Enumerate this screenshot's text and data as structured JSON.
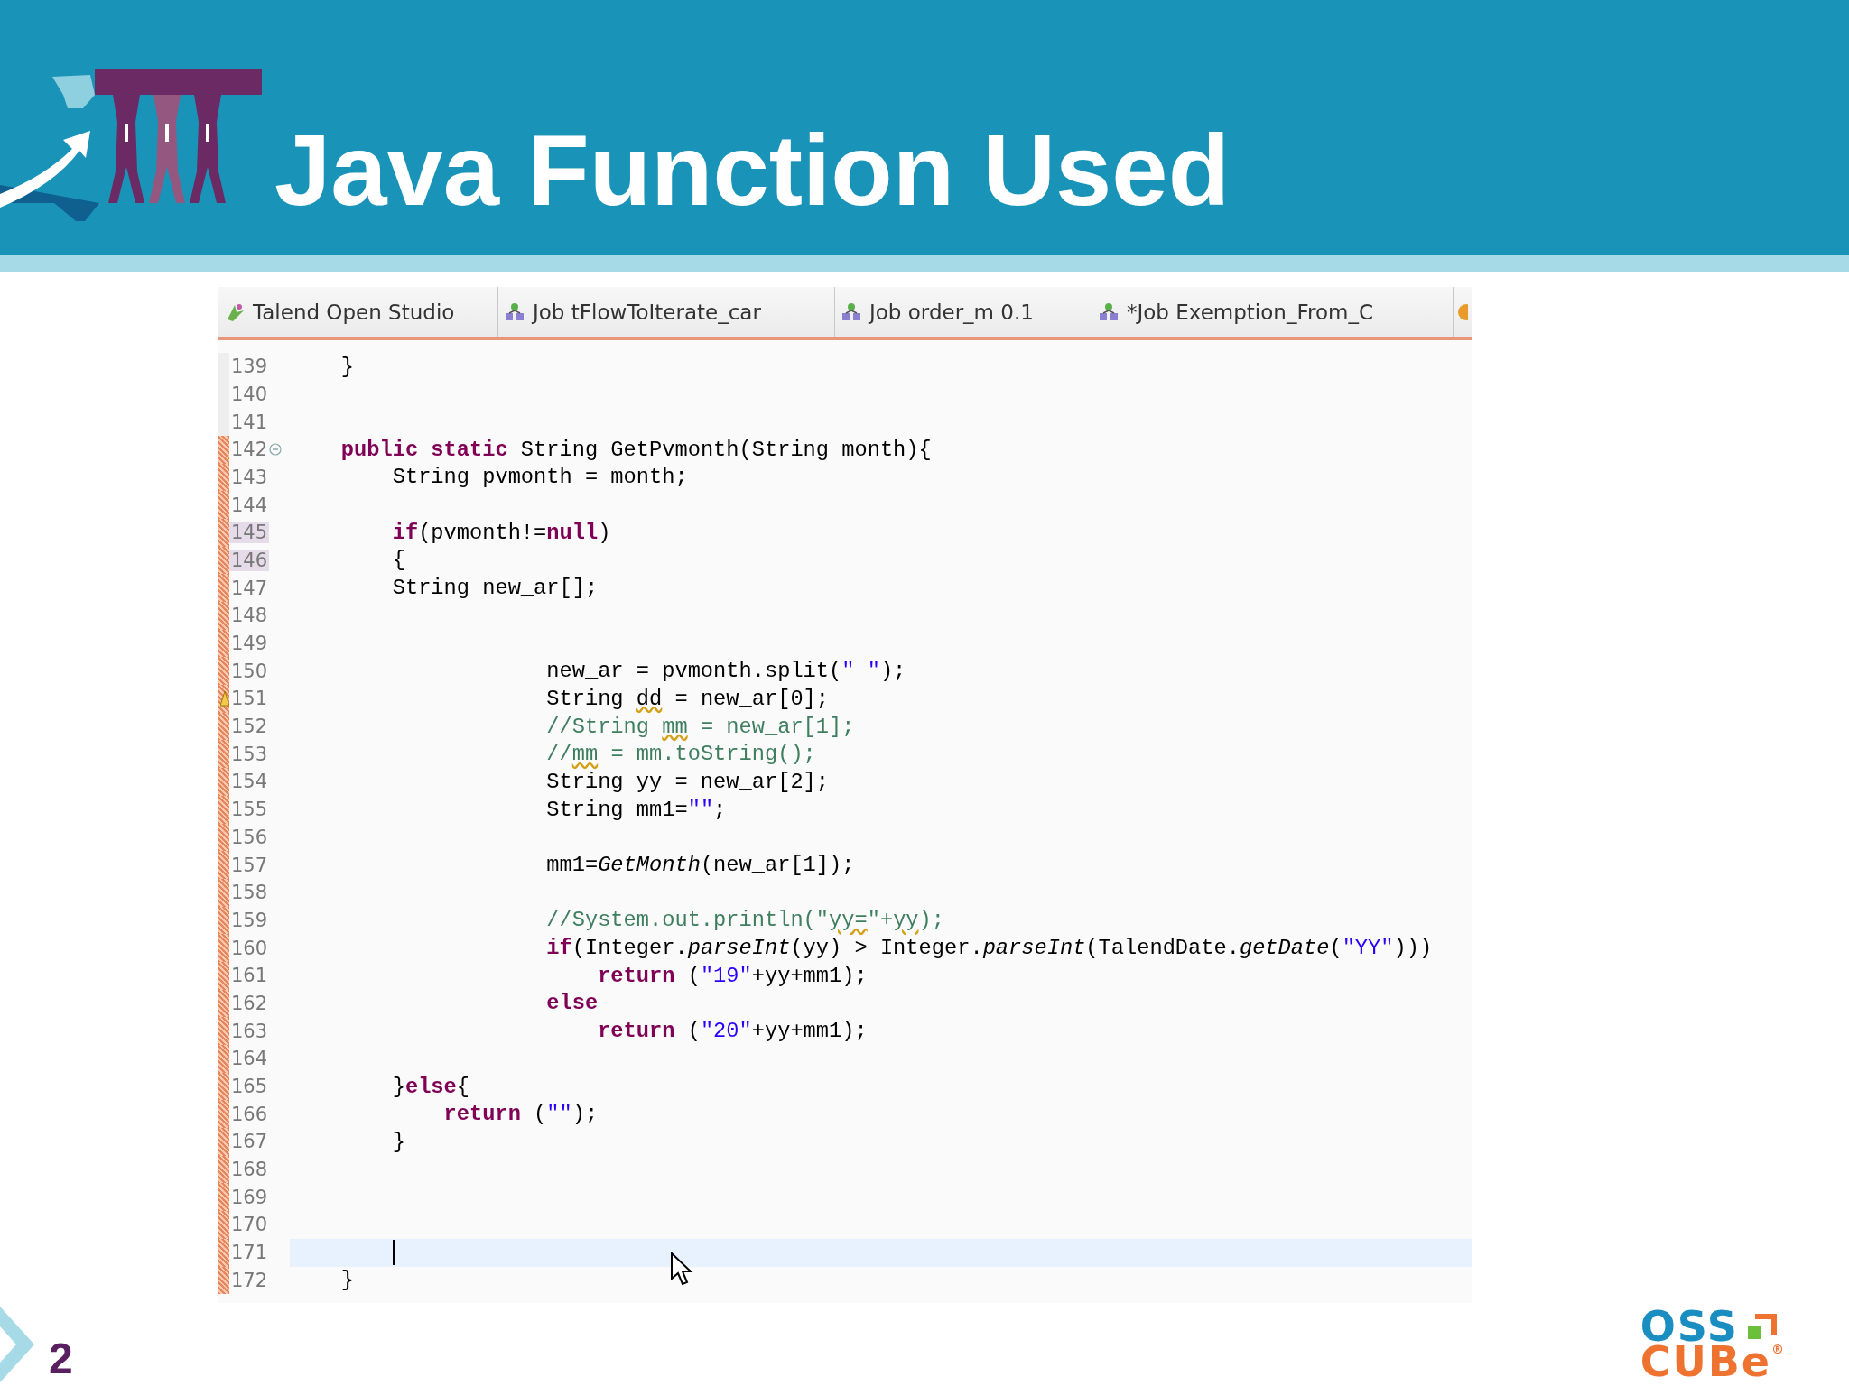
{
  "slide": {
    "title": "Java Function Used",
    "page_number": "2"
  },
  "editor": {
    "tabs": [
      {
        "label": "Talend Open Studio",
        "kind": "studio"
      },
      {
        "label": "Job tFlowToIterate_car",
        "kind": "job"
      },
      {
        "label": "Job order_m 0.1",
        "kind": "job"
      },
      {
        "label": "*Job Exemption_From_C",
        "kind": "job"
      }
    ],
    "lines": [
      {
        "number": "139",
        "changed": false,
        "highlighted": false,
        "current": false,
        "tokens": [
          {
            "kind": "plain",
            "text": "    }"
          }
        ]
      },
      {
        "number": "140",
        "changed": false,
        "highlighted": false,
        "current": false
      },
      {
        "number": "141",
        "changed": false,
        "highlighted": false,
        "current": false
      },
      {
        "number": "142",
        "changed": true,
        "highlighted": false,
        "current": false,
        "foldable": true,
        "tokens": [
          {
            "kind": "keyword",
            "text": "    public static"
          },
          {
            "kind": "plain",
            "text": " String GetPvmonth(String month){"
          }
        ]
      },
      {
        "number": "143",
        "changed": true,
        "highlighted": false,
        "current": false,
        "tokens": [
          {
            "kind": "plain",
            "text": "        String pvmonth = month;"
          }
        ]
      },
      {
        "number": "144",
        "changed": true,
        "highlighted": false,
        "current": false
      },
      {
        "number": "145",
        "changed": true,
        "highlighted": true,
        "current": false,
        "tokens": [
          {
            "kind": "keyword",
            "text": "        if"
          },
          {
            "kind": "plain",
            "text": "(pvmonth!="
          },
          {
            "kind": "keyword",
            "text": "null"
          },
          {
            "kind": "plain",
            "text": ")"
          }
        ]
      },
      {
        "number": "146",
        "changed": true,
        "highlighted": true,
        "current": false,
        "tokens": [
          {
            "kind": "plain",
            "text": "        {"
          }
        ]
      },
      {
        "number": "147",
        "changed": true,
        "highlighted": false,
        "current": false,
        "tokens": [
          {
            "kind": "plain",
            "text": "        String new_ar[];"
          }
        ]
      },
      {
        "number": "148",
        "changed": true,
        "highlighted": false,
        "current": false
      },
      {
        "number": "149",
        "changed": true,
        "highlighted": false,
        "current": false
      },
      {
        "number": "150",
        "changed": true,
        "highlighted": false,
        "current": false,
        "tokens": [
          {
            "kind": "plain",
            "text": "                    new_ar = pvmonth.split("
          },
          {
            "kind": "string",
            "text": "\" \""
          },
          {
            "kind": "plain",
            "text": ");"
          }
        ]
      },
      {
        "number": "151",
        "changed": true,
        "highlighted": false,
        "current": false,
        "warning": true,
        "tokens": [
          {
            "kind": "plain",
            "text": "                    String "
          },
          {
            "kind": "plain",
            "text": "dd",
            "squiggle": true
          },
          {
            "kind": "plain",
            "text": " = new_ar[0];"
          }
        ]
      },
      {
        "number": "152",
        "changed": true,
        "highlighted": false,
        "current": false,
        "tokens": [
          {
            "kind": "comment",
            "text": "                    //String "
          },
          {
            "kind": "comment",
            "text": "mm",
            "squiggle": true
          },
          {
            "kind": "comment",
            "text": " = new_ar[1];"
          }
        ]
      },
      {
        "number": "153",
        "changed": true,
        "highlighted": false,
        "current": false,
        "tokens": [
          {
            "kind": "comment",
            "text": "                    //"
          },
          {
            "kind": "comment",
            "text": "mm",
            "squiggle": true
          },
          {
            "kind": "comment",
            "text": " = mm.toString();"
          }
        ]
      },
      {
        "number": "154",
        "changed": true,
        "highlighted": false,
        "current": false,
        "tokens": [
          {
            "kind": "plain",
            "text": "                    String yy = new_ar[2];"
          }
        ]
      },
      {
        "number": "155",
        "changed": true,
        "highlighted": false,
        "current": false,
        "tokens": [
          {
            "kind": "plain",
            "text": "                    String mm1="
          },
          {
            "kind": "string",
            "text": "\"\""
          },
          {
            "kind": "plain",
            "text": ";"
          }
        ]
      },
      {
        "number": "156",
        "changed": true,
        "highlighted": false,
        "current": false
      },
      {
        "number": "157",
        "changed": true,
        "highlighted": false,
        "current": false,
        "tokens": [
          {
            "kind": "plain",
            "text": "                    mm1="
          },
          {
            "kind": "italic",
            "text": "GetMonth"
          },
          {
            "kind": "plain",
            "text": "(new_ar[1]);"
          }
        ]
      },
      {
        "number": "158",
        "changed": true,
        "highlighted": false,
        "current": false
      },
      {
        "number": "159",
        "changed": true,
        "highlighted": false,
        "current": false,
        "tokens": [
          {
            "kind": "comment",
            "text": "                    //System.out.println(\""
          },
          {
            "kind": "comment",
            "text": "yy=",
            "squiggle": true
          },
          {
            "kind": "comment",
            "text": "\"+"
          },
          {
            "kind": "comment",
            "text": "yy",
            "squiggle": true
          },
          {
            "kind": "comment",
            "text": ");"
          }
        ]
      },
      {
        "number": "160",
        "changed": true,
        "highlighted": false,
        "current": false,
        "tokens": [
          {
            "kind": "keyword",
            "text": "                    if"
          },
          {
            "kind": "plain",
            "text": "(Integer."
          },
          {
            "kind": "italic",
            "text": "parseInt"
          },
          {
            "kind": "plain",
            "text": "(yy) > Integer."
          },
          {
            "kind": "italic",
            "text": "parseInt"
          },
          {
            "kind": "plain",
            "text": "(TalendDate."
          },
          {
            "kind": "italic",
            "text": "getDate"
          },
          {
            "kind": "plain",
            "text": "("
          },
          {
            "kind": "string",
            "text": "\"YY\""
          },
          {
            "kind": "plain",
            "text": ")))"
          }
        ]
      },
      {
        "number": "161",
        "changed": true,
        "highlighted": false,
        "current": false,
        "tokens": [
          {
            "kind": "keyword",
            "text": "                        return"
          },
          {
            "kind": "plain",
            "text": " ("
          },
          {
            "kind": "string",
            "text": "\"19\""
          },
          {
            "kind": "plain",
            "text": "+yy+mm1);"
          }
        ]
      },
      {
        "number": "162",
        "changed": true,
        "highlighted": false,
        "current": false,
        "tokens": [
          {
            "kind": "keyword",
            "text": "                    else"
          }
        ]
      },
      {
        "number": "163",
        "changed": true,
        "highlighted": false,
        "current": false,
        "tokens": [
          {
            "kind": "keyword",
            "text": "                        return"
          },
          {
            "kind": "plain",
            "text": " ("
          },
          {
            "kind": "string",
            "text": "\"20\""
          },
          {
            "kind": "plain",
            "text": "+yy+mm1);"
          }
        ]
      },
      {
        "number": "164",
        "changed": true,
        "highlighted": false,
        "current": false
      },
      {
        "number": "165",
        "changed": true,
        "highlighted": false,
        "current": false,
        "tokens": [
          {
            "kind": "plain",
            "text": "        }"
          },
          {
            "kind": "keyword",
            "text": "else"
          },
          {
            "kind": "plain",
            "text": "{"
          }
        ]
      },
      {
        "number": "166",
        "changed": true,
        "highlighted": false,
        "current": false,
        "tokens": [
          {
            "kind": "keyword",
            "text": "            return"
          },
          {
            "kind": "plain",
            "text": " ("
          },
          {
            "kind": "string",
            "text": "\"\""
          },
          {
            "kind": "plain",
            "text": ");"
          }
        ]
      },
      {
        "number": "167",
        "changed": true,
        "highlighted": false,
        "current": false,
        "tokens": [
          {
            "kind": "plain",
            "text": "        }"
          }
        ]
      },
      {
        "number": "168",
        "changed": true,
        "highlighted": false,
        "current": false
      },
      {
        "number": "169",
        "changed": true,
        "highlighted": false,
        "current": false
      },
      {
        "number": "170",
        "changed": true,
        "highlighted": false,
        "current": false
      },
      {
        "number": "171",
        "changed": true,
        "highlighted": false,
        "current": true
      },
      {
        "number": "172",
        "changed": true,
        "highlighted": false,
        "current": false,
        "tokens": [
          {
            "kind": "plain",
            "text": "    }"
          }
        ]
      }
    ]
  },
  "logo": {
    "line_1": "OSS",
    "line_2": "CUBe",
    "registered": "®"
  }
}
